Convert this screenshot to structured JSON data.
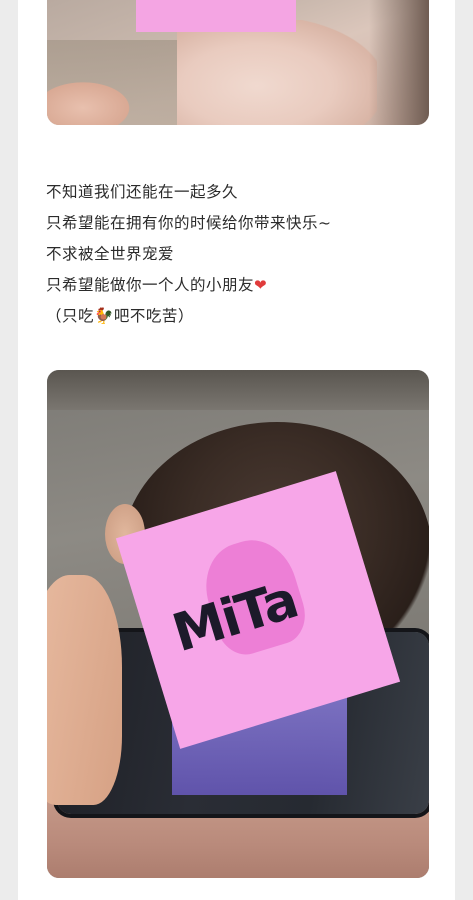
{
  "post": {
    "lines": [
      "不知道我们还能在一起多久",
      "只希望能在拥有你的时候给你带来快乐~",
      "不求被全世界宠爱",
      "只希望能做你一个人的小朋友",
      "（只吃",
      "吧不吃苦）"
    ],
    "heart_emoji": "❤",
    "chicken_emoji": "🐓"
  },
  "sticker": {
    "logo_text": "MiTa"
  },
  "colors": {
    "censor_pink": "#f4a5e3",
    "heart_red": "#e03b3b"
  }
}
